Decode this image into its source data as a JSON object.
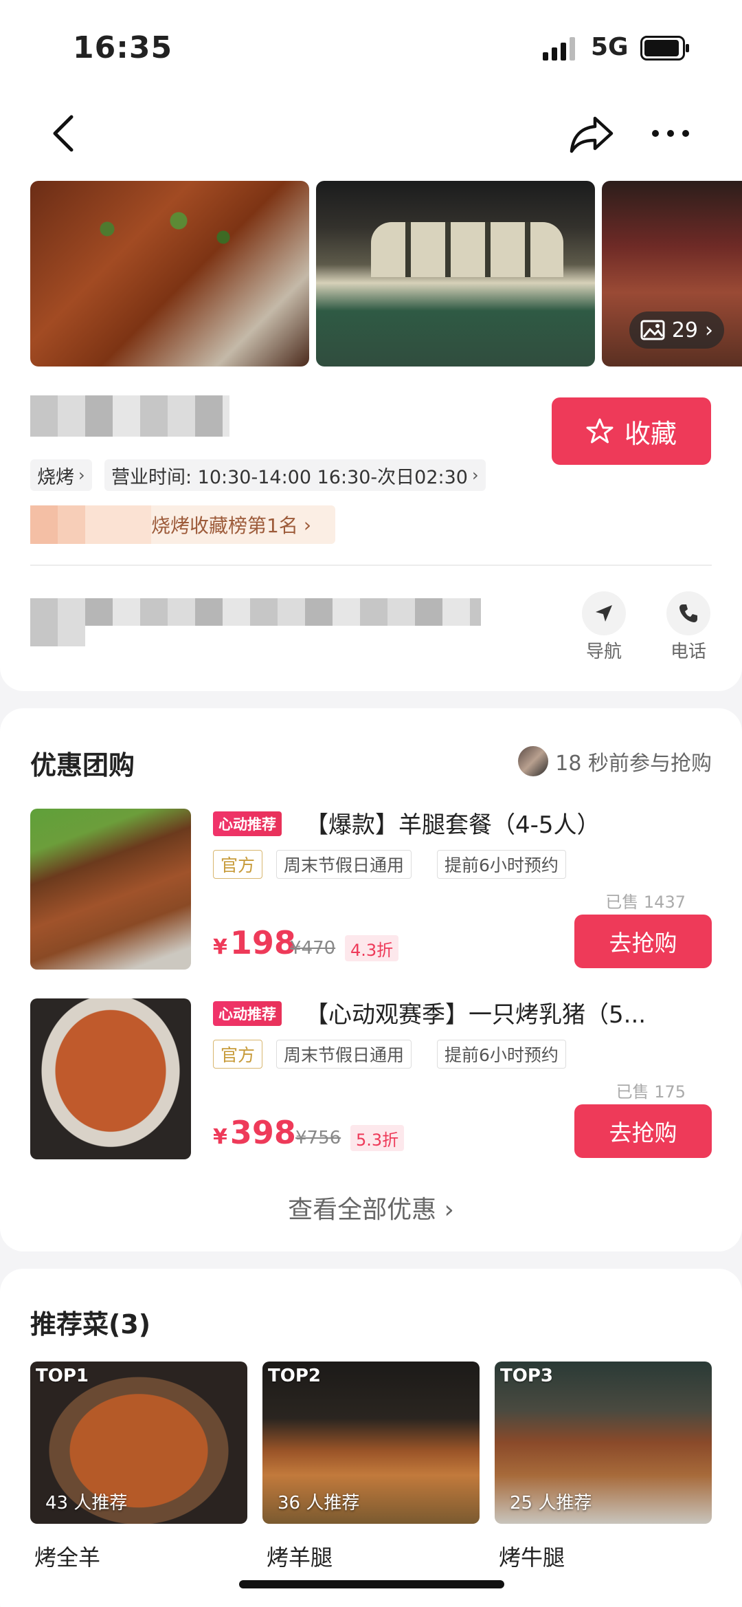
{
  "status_bar": {
    "time": "16:35",
    "network": "5G"
  },
  "gallery": {
    "photo_count": "29"
  },
  "store": {
    "favorite_label": "收藏",
    "category": "烧烤",
    "hours": "营业时间: 10:30-14:00 16:30-次日02:30",
    "rank": "烧烤收藏榜第1名",
    "nav_label": "导航",
    "phone_label": "电话"
  },
  "deals": {
    "title": "优惠团购",
    "joined": "18 秒前参与抢购",
    "items": [
      {
        "hot_tag": "心动推荐",
        "name": "【爆款】羊腿套餐（4-5人）",
        "tags": [
          "官方",
          "周末节假日通用",
          "提前6小时预约"
        ],
        "sold": "已售 1437",
        "currency": "¥",
        "price": "198",
        "original": "¥470",
        "discount": "4.3折",
        "buy": "去抢购"
      },
      {
        "hot_tag": "心动推荐",
        "name": "【心动观赛季】一只烤乳猪（5...",
        "tags": [
          "官方",
          "周末节假日通用",
          "提前6小时预约"
        ],
        "sold": "已售 175",
        "currency": "¥",
        "price": "398",
        "original": "¥756",
        "discount": "5.3折",
        "buy": "去抢购"
      }
    ],
    "see_all": "查看全部优惠"
  },
  "dishes": {
    "title": "推荐菜(3)",
    "items": [
      {
        "rank": "TOP1",
        "recommend": "43 人推荐",
        "name": "烤全羊"
      },
      {
        "rank": "TOP2",
        "recommend": "36 人推荐",
        "name": "烤羊腿"
      },
      {
        "rank": "TOP3",
        "recommend": "25 人推荐",
        "name": "烤牛腿"
      }
    ]
  },
  "colors": {
    "accent": "#ee3a59",
    "official": "#c79b3a"
  }
}
